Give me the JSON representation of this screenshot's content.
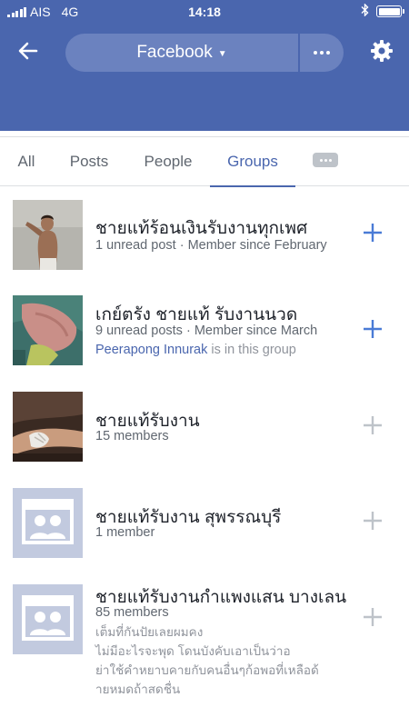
{
  "status_bar": {
    "carrier": "AIS",
    "network": "4G",
    "time": "14:18"
  },
  "header": {
    "title": "Facebook",
    "back_icon": "arrow-left-icon",
    "more_icon": "more-dots-icon",
    "settings_icon": "gear-icon",
    "color": "#4a66ae"
  },
  "tabs": [
    {
      "label": "All",
      "active": false
    },
    {
      "label": "Posts",
      "active": false
    },
    {
      "label": "People",
      "active": false
    },
    {
      "label": "Groups",
      "active": true
    }
  ],
  "groups": [
    {
      "name": "ชายแท้ร้อนเงินรับงานทุกเพศ",
      "meta": "1 unread post · Member since February",
      "add_active": true
    },
    {
      "name": "เกย์ตรัง ชายแท้ รับงานนวด",
      "meta": "9 unread posts · Member since March",
      "member_name": "Peerapong Innurak",
      "member_suffix": " is in this group",
      "add_active": true
    },
    {
      "name": "ชายแท้รับงาน",
      "meta": "15 members",
      "add_active": false
    },
    {
      "name": "ชายแท้รับงาน สุพรรณบุรี",
      "meta": "1 member",
      "add_active": false
    },
    {
      "name": "ชายแท้รับงานกำแพงแสน บางเลน",
      "meta": "85 members",
      "description": [
        "เต็มที่กันปัยเลยผมคง",
        "ไม่มีอะไรจะพุด โดนบังคับเอาเป็นว่าอ",
        "ย่าใช้คำหยาบคายกับคนอื่นๆก้อพอที่เหลือด้",
        "ายหมดถ้าสดชื่น"
      ],
      "add_active": false
    }
  ],
  "colors": {
    "accent": "#4a66ae",
    "add_active": "#4a7bd6",
    "add_inactive": "#bec3c9"
  }
}
